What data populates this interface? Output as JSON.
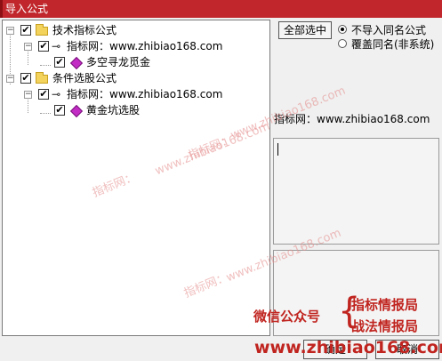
{
  "window": {
    "title": "导入公式"
  },
  "tree": {
    "nodes": [
      {
        "label": "技术指标公式",
        "checked": true,
        "expanded": true
      },
      {
        "label": "指标网：www.zhibiao168.com",
        "checked": true,
        "expanded": true
      },
      {
        "label": "多空寻龙觅金",
        "checked": true
      },
      {
        "label": "条件选股公式",
        "checked": true,
        "expanded": true
      },
      {
        "label": "指标网：www.zhibiao168.com",
        "checked": true,
        "expanded": true
      },
      {
        "label": "黄金坑选股",
        "checked": true
      }
    ],
    "checkmark": "✔",
    "expanded_symbol": "−"
  },
  "buttons": {
    "select_all": "全部选中",
    "ok": "确定",
    "cancel": "取消"
  },
  "options": [
    {
      "label": "不导入同名公式",
      "selected": true
    },
    {
      "label": "覆盖同名(非系统)",
      "selected": false
    }
  ],
  "info_text": "指标网：www.zhibiao168.com",
  "watermarks": [
    "www.zhibiao168.com",
    "指标网：",
    "www.zhibiao168.com",
    "指标网：",
    "www.zhibiao168.com",
    "指标网："
  ],
  "promo": {
    "wechat": "微信公众号",
    "line1": "指标情报局",
    "line2": "战法情报局",
    "url": "www.zhibiao168.com",
    "brace": "{"
  },
  "colors": {
    "titlebar": "#c0262b",
    "promo": "#c0241f",
    "gem": "#c22cc4",
    "folder": "#f3d35c"
  },
  "icons": {
    "folder": "folder-icon",
    "key": "key-icon",
    "formula": "gem-icon"
  }
}
